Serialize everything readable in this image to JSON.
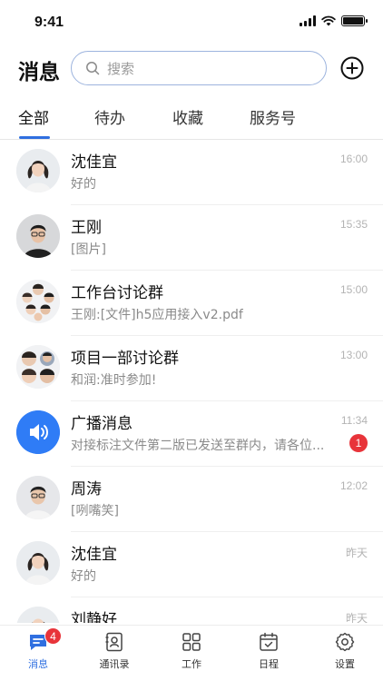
{
  "status_bar": {
    "time": "9:41"
  },
  "header": {
    "title": "消息"
  },
  "search": {
    "placeholder": "搜索"
  },
  "tabs": [
    {
      "label": "全部",
      "active": true
    },
    {
      "label": "待办",
      "active": false
    },
    {
      "label": "收藏",
      "active": false
    },
    {
      "label": "服务号",
      "active": false
    }
  ],
  "conversations": [
    {
      "name": "沈佳宜",
      "preview": "好的",
      "time": "16:00",
      "avatar": "person-avatar"
    },
    {
      "name": "王刚",
      "preview": "[图片]",
      "time": "15:35",
      "avatar": "person-avatar"
    },
    {
      "name": "工作台讨论群",
      "preview": "王刚:[文件]h5应用接入v2.pdf",
      "time": "15:00",
      "avatar": "group-avatar"
    },
    {
      "name": "项目一部讨论群",
      "preview": "和润:准时参加!",
      "time": "13:00",
      "avatar": "group-avatar"
    },
    {
      "name": "广播消息",
      "preview": "对接标注文件第二版已发送至群内，请各位...",
      "time": "11:34",
      "avatar": "speaker-icon",
      "unread": "1"
    },
    {
      "name": "周涛",
      "preview": "[咧嘴笑]",
      "time": "12:02",
      "avatar": "person-avatar"
    },
    {
      "name": "沈佳宜",
      "preview": "好的",
      "time": "昨天",
      "avatar": "person-avatar"
    },
    {
      "name": "刘静好",
      "preview": "",
      "time": "昨天",
      "avatar": "person-avatar"
    }
  ],
  "tabbar": [
    {
      "label": "消息",
      "icon": "message-icon",
      "badge": "4",
      "active": true
    },
    {
      "label": "通讯录",
      "icon": "contacts-icon",
      "active": false
    },
    {
      "label": "工作",
      "icon": "grid-icon",
      "active": false
    },
    {
      "label": "日程",
      "icon": "calendar-icon",
      "active": false
    },
    {
      "label": "设置",
      "icon": "gear-icon",
      "active": false
    }
  ],
  "colors": {
    "accent": "#2f6fe0",
    "badge": "#e8343a",
    "broadcast": "#2f7cf6"
  }
}
